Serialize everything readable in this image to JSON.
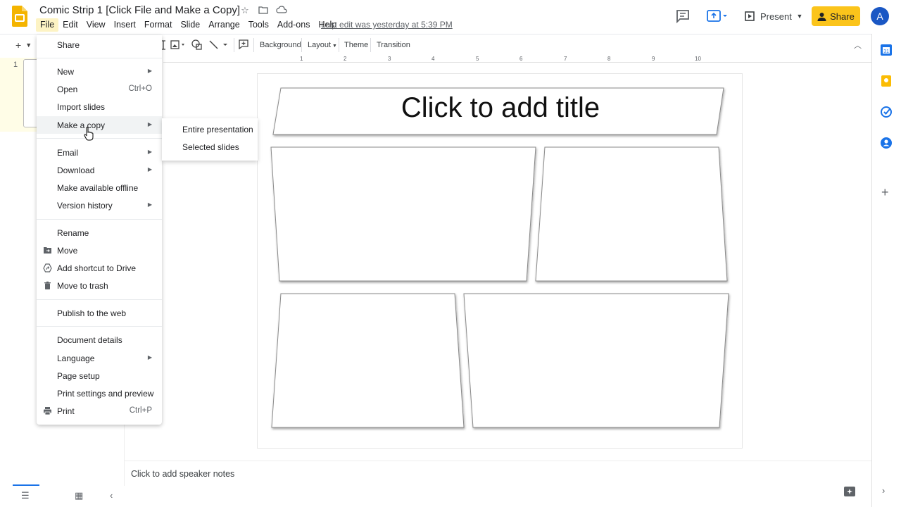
{
  "header": {
    "title": "Comic Strip 1 [Click File and Make a Copy]",
    "last_edit": "Last edit was yesterday at 5:39 PM",
    "present_label": "Present",
    "share_label": "Share",
    "avatar_letter": "A"
  },
  "menubar": [
    "File",
    "Edit",
    "View",
    "Insert",
    "Format",
    "Slide",
    "Arrange",
    "Tools",
    "Add-ons",
    "Help"
  ],
  "toolbar": {
    "background": "Background",
    "layout": "Layout",
    "theme": "Theme",
    "transition": "Transition"
  },
  "ruler": [
    "1",
    "2",
    "3",
    "4",
    "5",
    "6",
    "7",
    "8",
    "9",
    "10"
  ],
  "filmstrip": {
    "slide_number": "1"
  },
  "file_menu": {
    "share": "Share",
    "new": "New",
    "open": "Open",
    "open_shortcut": "Ctrl+O",
    "import_slides": "Import slides",
    "make_copy": "Make a copy",
    "email": "Email",
    "download": "Download",
    "offline": "Make available offline",
    "version_history": "Version history",
    "rename": "Rename",
    "move": "Move",
    "add_shortcut": "Add shortcut to Drive",
    "trash": "Move to trash",
    "publish": "Publish to the web",
    "details": "Document details",
    "language": "Language",
    "page_setup": "Page setup",
    "print_settings": "Print settings and preview",
    "print": "Print",
    "print_shortcut": "Ctrl+P"
  },
  "submenu": {
    "entire": "Entire presentation",
    "selected": "Selected slides"
  },
  "slide": {
    "title_placeholder": "Click to add title"
  },
  "notes": {
    "placeholder": "Click to add speaker notes"
  },
  "colors": {
    "accent": "#1a73e8",
    "share": "#fbc41b",
    "logo": "#f4b400"
  }
}
